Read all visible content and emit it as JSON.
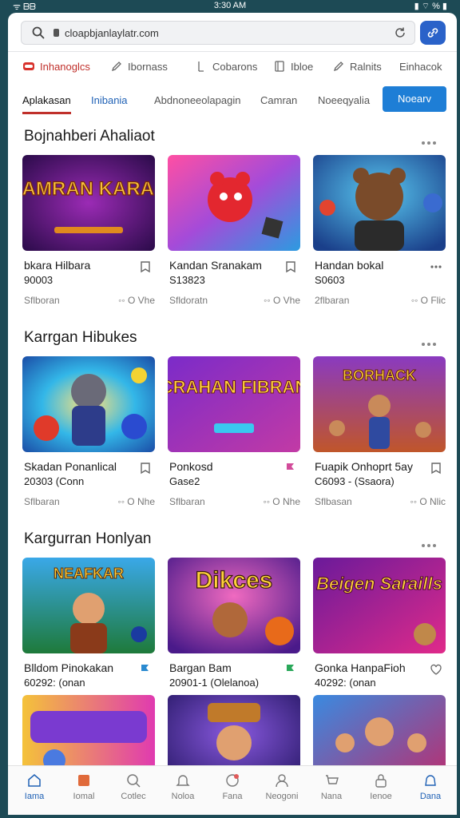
{
  "status_bar": {
    "left": "ᯤ ᗷᗷ",
    "time": "3:30 AM",
    "right": "▮ ⌔ % ▮"
  },
  "browser": {
    "url": "cloapbjanlaylatr.com"
  },
  "categories": [
    {
      "label": "Inhanoglcs",
      "icon": "gamepad-icon"
    },
    {
      "label": "Ibornass",
      "icon": "pen-icon"
    },
    {
      "label": "Cobarons",
      "icon": "bookmark-icon"
    },
    {
      "label": "Ibloe",
      "icon": "book-icon"
    },
    {
      "label": "Ralnits",
      "icon": "pen-icon"
    },
    {
      "label": "Einhacok",
      "icon": "box-icon"
    }
  ],
  "tabs": [
    "Aplakasan",
    "Inibania",
    "Abdnoneeolapagin",
    "Camran",
    "Noeeqyalia"
  ],
  "tab_button": "Noearv",
  "sections": [
    {
      "title": "Bojnahberi Ahaliaot",
      "cards": [
        {
          "title": "bkara Hilbara",
          "sub": "90003",
          "meta": "Sflboran",
          "stat": "◦◦ O Vhe",
          "thumb_text": "SAMRAN KARAN"
        },
        {
          "title": "Kandan Sranakam",
          "sub": "S13823",
          "meta": "Sfldoratn",
          "stat": "◦◦ O Vhe",
          "thumb_text": ""
        },
        {
          "title": "Handan bokal",
          "sub": "S0603",
          "meta": "2flbaran",
          "stat": "◦◦ O Flic",
          "thumb_text": ""
        }
      ]
    },
    {
      "title": "Karrgan Hibukes",
      "cards": [
        {
          "title": "Skadan Ponanlical",
          "sub": "20303 (Conn",
          "meta": "Sflbaran",
          "stat": "◦◦ O Nhe",
          "thumb_text": ""
        },
        {
          "title": "Ponkosd",
          "sub": "Gase2",
          "meta": "Sflbaran",
          "stat": "◦◦ O Nhe",
          "thumb_text": "CRAHAN FIBRAN"
        },
        {
          "title": "Fuapik Onhoprt 5ay",
          "sub": "C6093 - (Ssaora)",
          "meta": "Sflbasan",
          "stat": "◦◦ O Nlic",
          "thumb_text": "BORHACK"
        }
      ]
    },
    {
      "title": "Kargurran Honlyan",
      "cards": [
        {
          "title": "Blldom Pinokakan",
          "sub": "60292: (onan",
          "meta": "",
          "stat": "",
          "thumb_text": "NEAFKAR"
        },
        {
          "title": "Bargan Bam",
          "sub": "20901-1 (Olelanoa)",
          "meta": "",
          "stat": "",
          "thumb_text": "Dikces"
        },
        {
          "title": "Gonka HanpaFioh",
          "sub": "40292: (onan",
          "meta": "",
          "stat": "",
          "thumb_text": "Beigen Saraills"
        }
      ]
    }
  ],
  "bottom_nav": [
    {
      "label": "Iama",
      "icon": "home-icon"
    },
    {
      "label": "Iomal",
      "icon": "store-icon"
    },
    {
      "label": "Cotlec",
      "icon": "search-icon"
    },
    {
      "label": "Noloa",
      "icon": "bell-icon"
    },
    {
      "label": "Fana",
      "icon": "controller-icon"
    },
    {
      "label": "Neogoni",
      "icon": "user-icon"
    },
    {
      "label": "Nana",
      "icon": "cart-icon"
    },
    {
      "label": "Ienoe",
      "icon": "lock-icon"
    },
    {
      "label": "Dana",
      "icon": "profile-icon"
    }
  ]
}
